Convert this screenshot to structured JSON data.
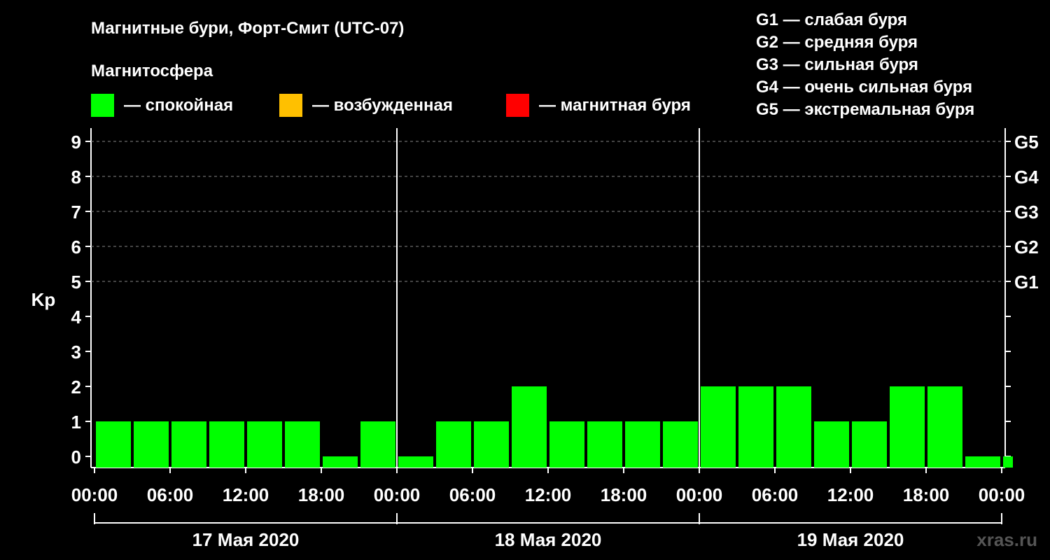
{
  "chart_data": {
    "type": "bar",
    "title": "Магнитные бури, Форт-Смит (UTC-07)",
    "legend": {
      "heading": "Магнитосфера",
      "items": [
        {
          "label": "— спокойная",
          "color": "#00ff00"
        },
        {
          "label": "— возбужденная",
          "color": "#ffc000"
        },
        {
          "label": "— магнитная буря",
          "color": "#ff0000"
        }
      ],
      "storm_scale": [
        "G1 — слабая буря",
        "G2 — средняя буря",
        "G3 — сильная буря",
        "G4 — очень сильная буря",
        "G5 — экстремальная буря"
      ]
    },
    "ylabel": "Kp",
    "ylim": [
      0,
      9
    ],
    "y_ticks": [
      0,
      1,
      2,
      3,
      4,
      5,
      6,
      7,
      8,
      9
    ],
    "right_ticks": [
      {
        "kp": 5,
        "label": "G1"
      },
      {
        "kp": 6,
        "label": "G2"
      },
      {
        "kp": 7,
        "label": "G3"
      },
      {
        "kp": 8,
        "label": "G4"
      },
      {
        "kp": 9,
        "label": "G5"
      }
    ],
    "grid": "dashed horizontal lines at Kp 5–9",
    "x_range_hours": [
      -1,
      71
    ],
    "x_tick_hours": [
      0,
      6,
      12,
      18,
      24,
      30,
      36,
      42,
      48,
      54,
      60,
      66,
      72
    ],
    "x_tick_labels": [
      "00:00",
      "06:00",
      "12:00",
      "18:00",
      "00:00",
      "06:00",
      "12:00",
      "18:00",
      "00:00",
      "06:00",
      "12:00",
      "18:00",
      "00:00"
    ],
    "day_dividers_hours": [
      23,
      47
    ],
    "days": [
      {
        "label": "17 Мая 2020",
        "start": -1,
        "end": 23
      },
      {
        "label": "18 Мая 2020",
        "start": 23,
        "end": 47
      },
      {
        "label": "19 Мая 2020",
        "start": 47,
        "end": 71
      }
    ],
    "bars": [
      {
        "start": -1,
        "end": 2,
        "kp": 1,
        "status": "спокойная"
      },
      {
        "start": 2,
        "end": 5,
        "kp": 1,
        "status": "спокойная"
      },
      {
        "start": 5,
        "end": 8,
        "kp": 1,
        "status": "спокойная"
      },
      {
        "start": 8,
        "end": 11,
        "kp": 1,
        "status": "спокойная"
      },
      {
        "start": 11,
        "end": 14,
        "kp": 1,
        "status": "спокойная"
      },
      {
        "start": 14,
        "end": 17,
        "kp": 1,
        "status": "спокойная"
      },
      {
        "start": 17,
        "end": 20,
        "kp": 0,
        "status": "спокойная"
      },
      {
        "start": 20,
        "end": 23,
        "kp": 1,
        "status": "спокойная"
      },
      {
        "start": 23,
        "end": 26,
        "kp": 0,
        "status": "спокойная"
      },
      {
        "start": 26,
        "end": 29,
        "kp": 1,
        "status": "спокойная"
      },
      {
        "start": 29,
        "end": 32,
        "kp": 1,
        "status": "спокойная"
      },
      {
        "start": 32,
        "end": 35,
        "kp": 2,
        "status": "спокойная"
      },
      {
        "start": 35,
        "end": 38,
        "kp": 1,
        "status": "спокойная"
      },
      {
        "start": 38,
        "end": 41,
        "kp": 1,
        "status": "спокойная"
      },
      {
        "start": 41,
        "end": 44,
        "kp": 1,
        "status": "спокойная"
      },
      {
        "start": 44,
        "end": 47,
        "kp": 1,
        "status": "спокойная"
      },
      {
        "start": 47,
        "end": 50,
        "kp": 2,
        "status": "спокойная"
      },
      {
        "start": 50,
        "end": 53,
        "kp": 2,
        "status": "спокойная"
      },
      {
        "start": 53,
        "end": 56,
        "kp": 2,
        "status": "спокойная"
      },
      {
        "start": 56,
        "end": 59,
        "kp": 1,
        "status": "спокойная"
      },
      {
        "start": 59,
        "end": 62,
        "kp": 1,
        "status": "спокойная"
      },
      {
        "start": 62,
        "end": 65,
        "kp": 2,
        "status": "спокойная"
      },
      {
        "start": 65,
        "end": 68,
        "kp": 2,
        "status": "спокойная"
      },
      {
        "start": 68,
        "end": 71,
        "kp": 0,
        "status": "спокойная"
      },
      {
        "start": 71,
        "end": 72,
        "kp": 0,
        "status": "спокойная"
      }
    ]
  },
  "watermark": "xras.ru"
}
